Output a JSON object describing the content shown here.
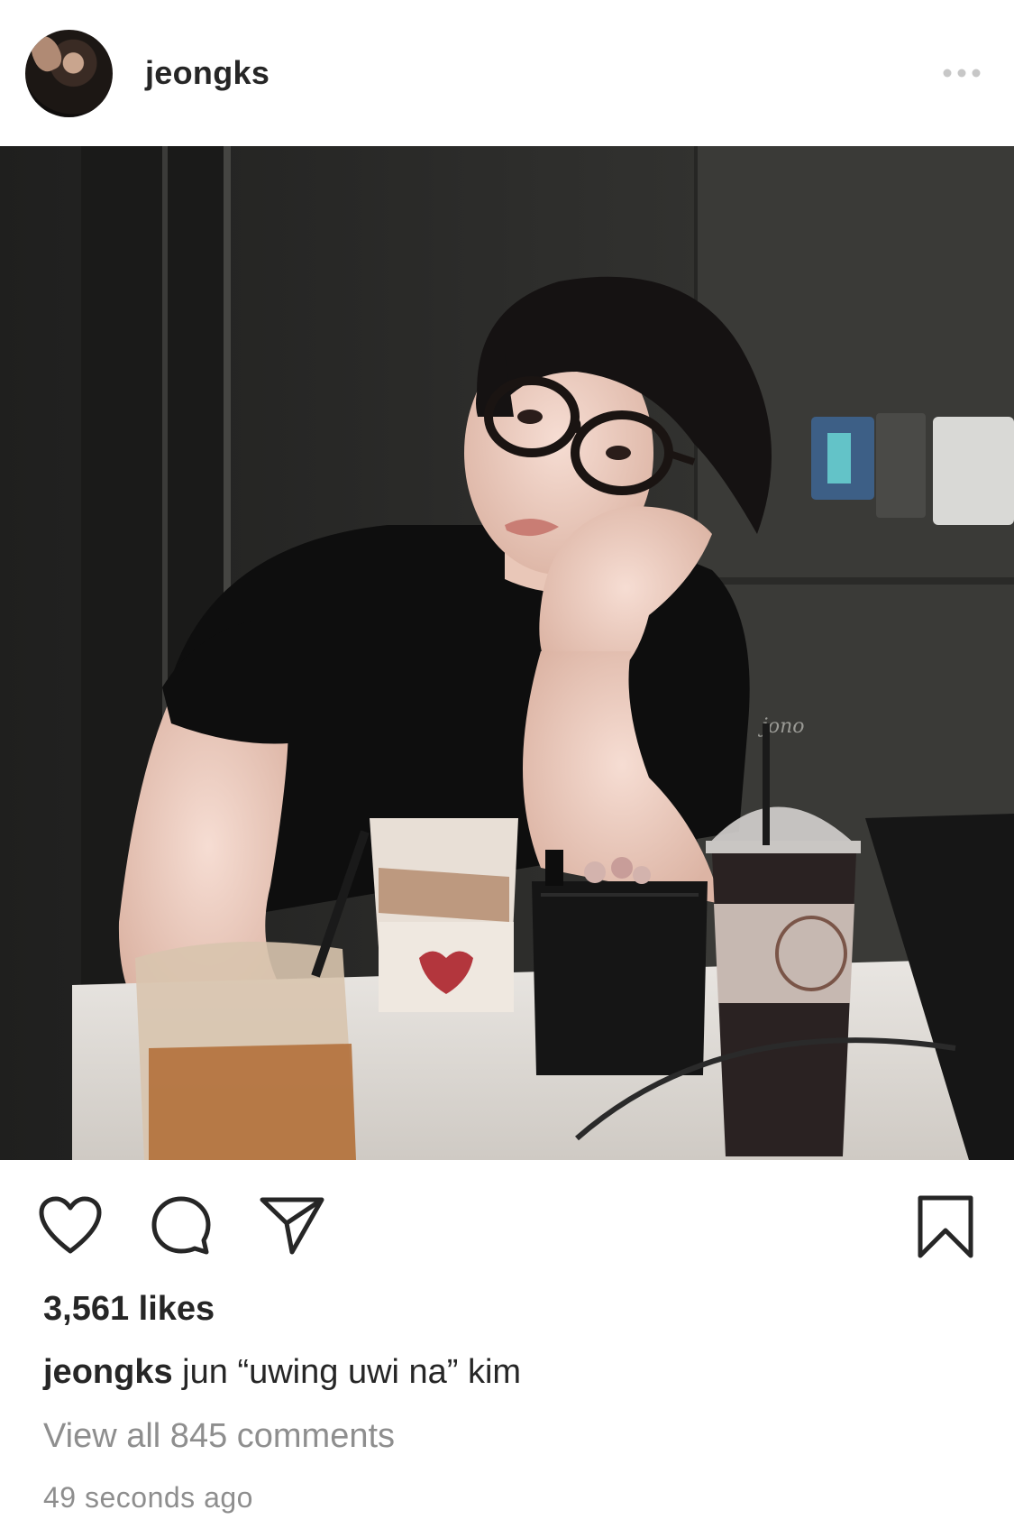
{
  "post": {
    "username": "jeongks",
    "likes_text": "3,561 likes",
    "caption_user": "jeongks",
    "caption_text": "jun “uwing uwi na” kim",
    "view_comments": "View all 845 comments",
    "timestamp": "49 seconds ago",
    "photo_watermark": "jono"
  },
  "icons": {
    "more": "more-horizontal-icon",
    "like": "heart-icon",
    "comment": "comment-bubble-icon",
    "share": "paper-plane-icon",
    "save": "bookmark-icon"
  },
  "colors": {
    "text": "#262626",
    "secondary_text": "#8e8e8e",
    "background": "#ffffff"
  }
}
